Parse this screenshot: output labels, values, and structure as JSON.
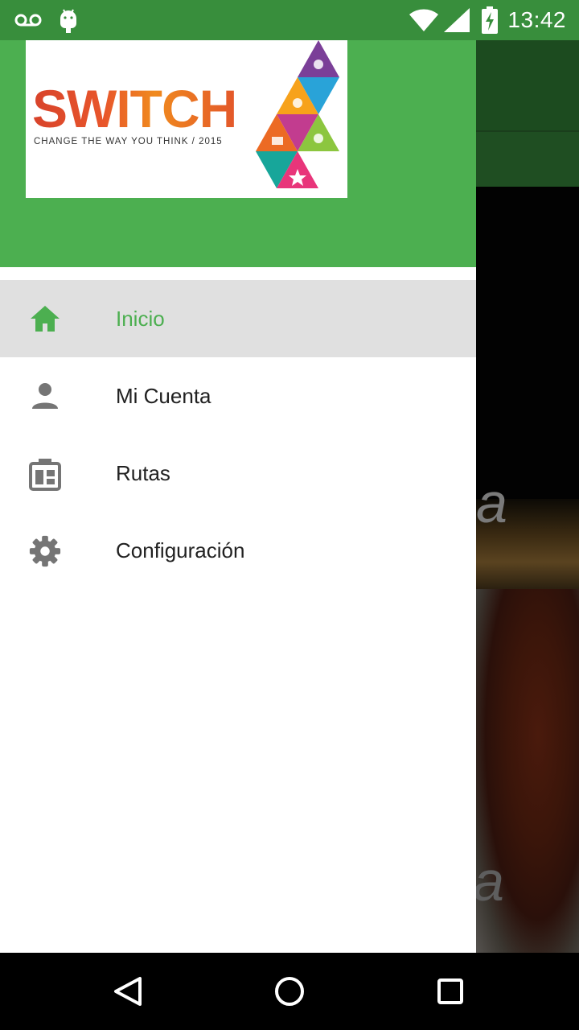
{
  "status_bar": {
    "time": "13:42",
    "icons": [
      "voicemail-icon",
      "android-icon",
      "wifi-icon",
      "signal-icon",
      "battery-charging-icon"
    ]
  },
  "drawer": {
    "header": {
      "logo_title": "SWITCH",
      "logo_subtitle": "CHANGE THE WAY YOU THINK / 2015",
      "color": "#4CAF50"
    },
    "menu": [
      {
        "label": "Inicio",
        "icon": "home-icon",
        "active": true
      },
      {
        "label": "Mi Cuenta",
        "icon": "person-icon",
        "active": false
      },
      {
        "label": "Rutas",
        "icon": "routes-icon",
        "active": false
      },
      {
        "label": "Configuración",
        "icon": "gear-icon",
        "active": false
      }
    ],
    "active_color": "#4CAF50"
  },
  "nav_bar": {
    "buttons": [
      "back-icon",
      "home-circle-icon",
      "recents-icon"
    ]
  }
}
